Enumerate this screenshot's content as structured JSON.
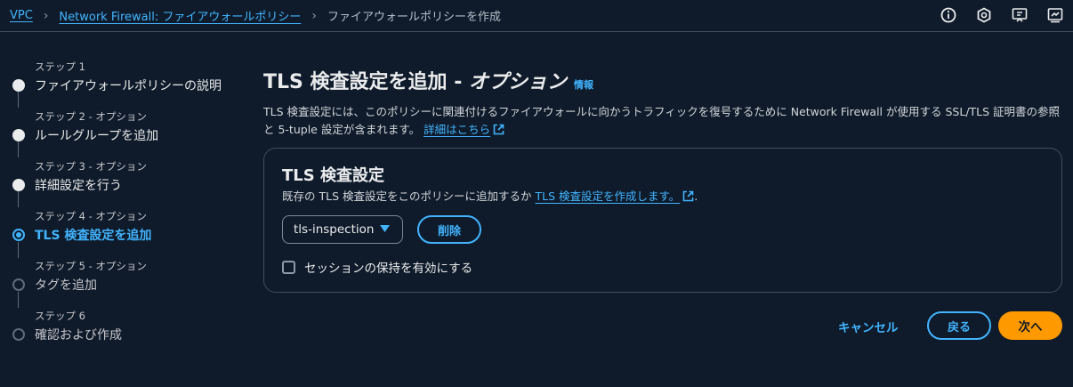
{
  "breadcrumb": {
    "items": [
      "VPC",
      "Network Firewall: ファイアウォールポリシー"
    ],
    "current": "ファイアウォールポリシーを作成"
  },
  "top_icons": [
    "info-circle-icon",
    "hexagon-settings-icon",
    "feedback-screen-icon",
    "dashboard-screen-icon"
  ],
  "steps": [
    {
      "caption": "ステップ 1",
      "title": "ファイアウォールポリシーの説明",
      "state": "done"
    },
    {
      "caption": "ステップ 2 - オプション",
      "title": "ルールグループを追加",
      "state": "done"
    },
    {
      "caption": "ステップ 3 - オプション",
      "title": "詳細設定を行う",
      "state": "done"
    },
    {
      "caption": "ステップ 4 - オプション",
      "title": "TLS 検査設定を追加",
      "state": "current"
    },
    {
      "caption": "ステップ 5 - オプション",
      "title": "タグを追加",
      "state": "future"
    },
    {
      "caption": "ステップ 6",
      "title": "確認および作成",
      "state": "future"
    }
  ],
  "page": {
    "title": "TLS 検査設定を追加 - ",
    "title_optional": "オプション",
    "info_link": "情報",
    "description": "TLS 検査設定には、このポリシーに関連付けるファイアウォールに向かうトラフィックを復号するために Network Firewall が使用する SSL/TLS 証明書の参照と 5-tuple 設定が含まれます。",
    "learn_more": "詳細はこちら"
  },
  "card": {
    "title": "TLS 検査設定",
    "description": "既存の TLS 検査設定をこのポリシーに追加するか ",
    "create_link": "TLS 検査設定を作成します。",
    "description_end": ".",
    "select_value": "tls-inspection",
    "delete_button": "削除",
    "checkbox_label": "セッションの保持を有効にする",
    "checkbox_checked": false
  },
  "footer": {
    "cancel": "キャンセル",
    "back": "戻る",
    "next": "次へ"
  },
  "colors": {
    "background": "#0f1b2a",
    "link": "#42b4ff",
    "primary": "#ff9900"
  }
}
